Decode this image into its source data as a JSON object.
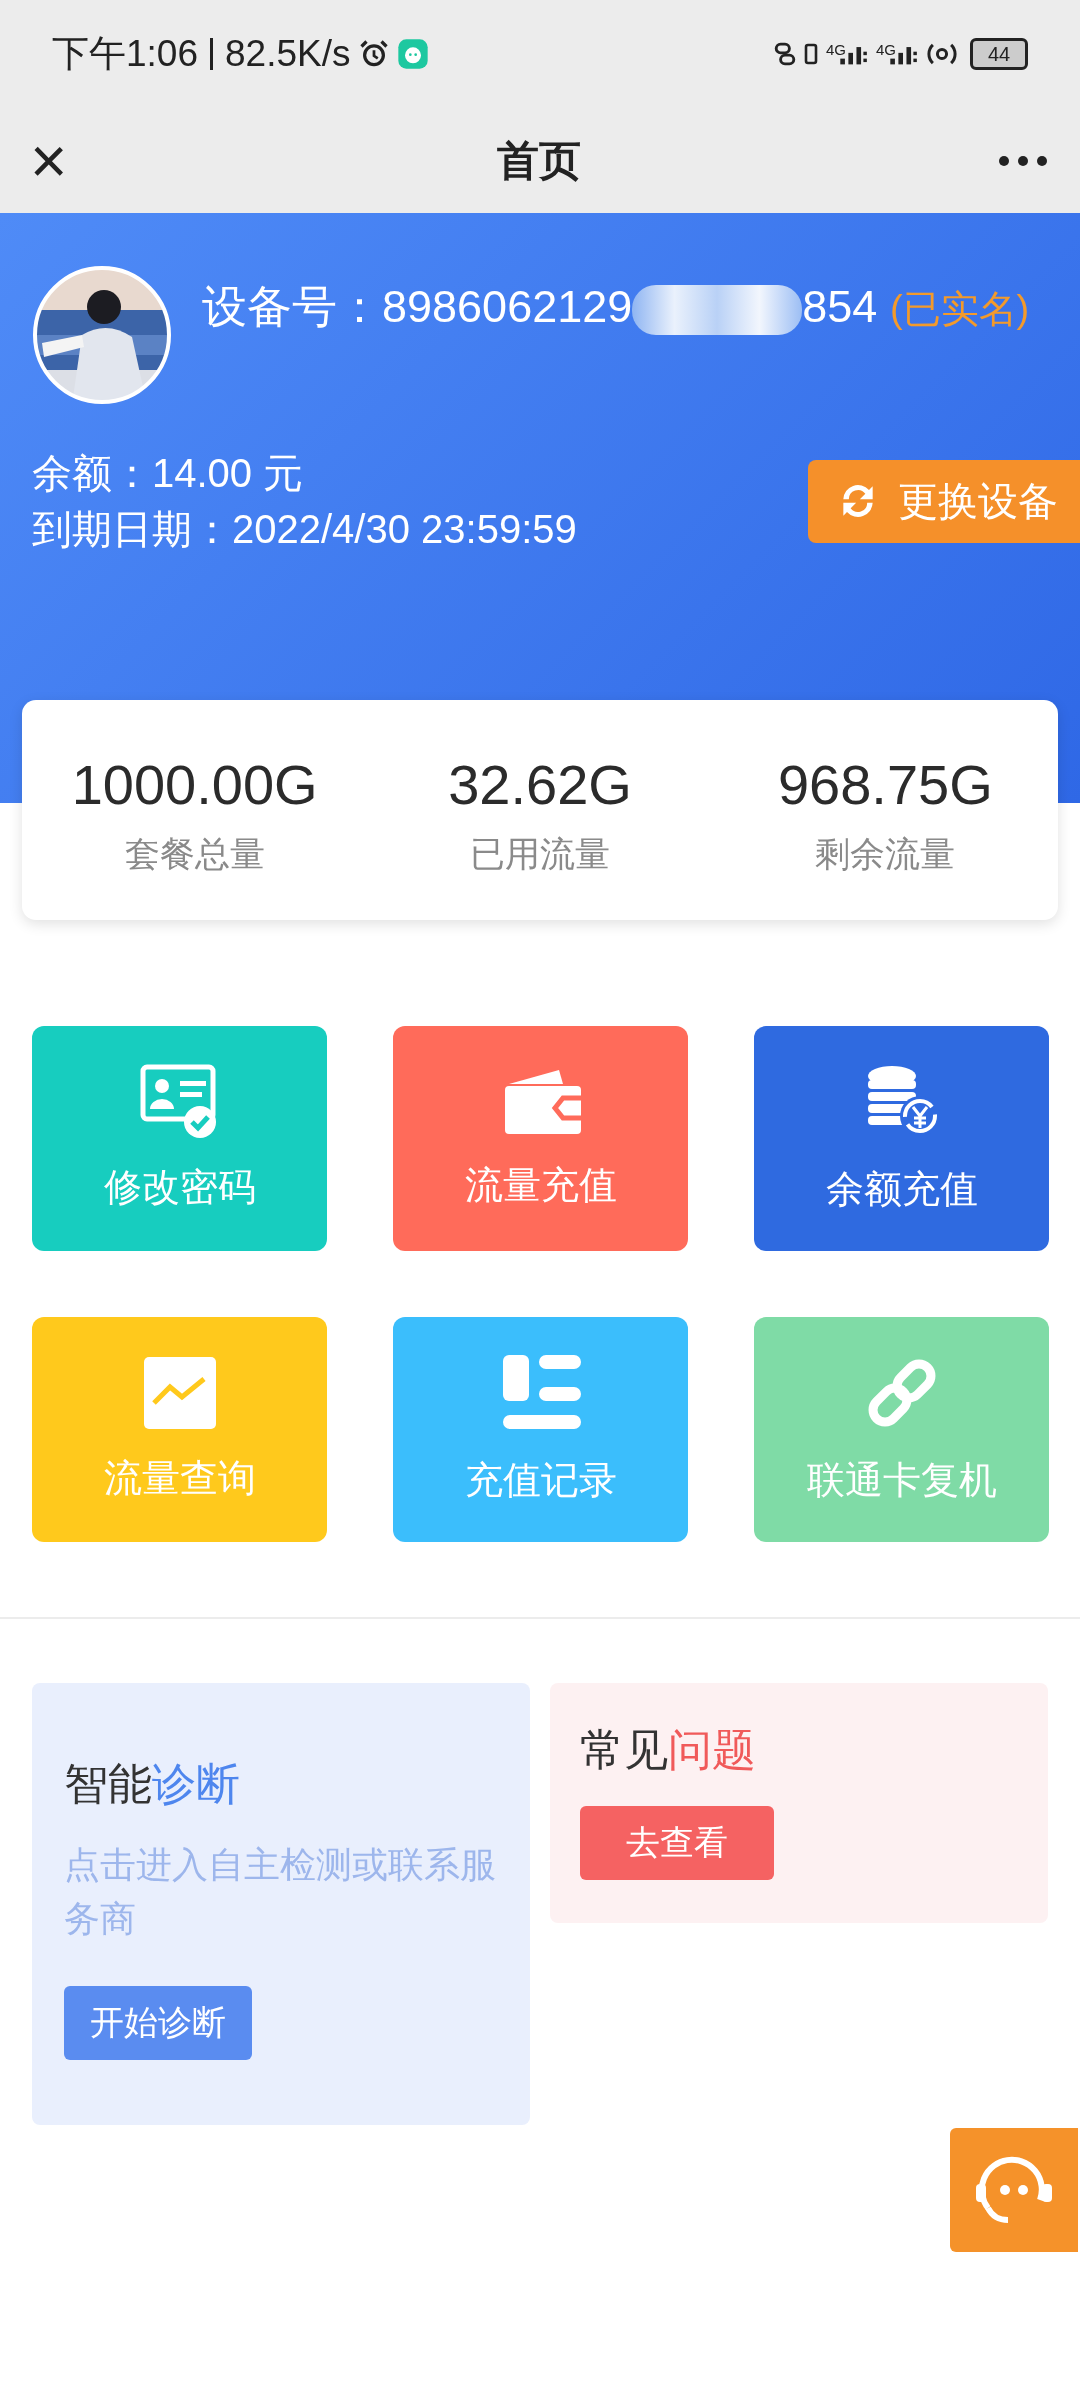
{
  "status_bar": {
    "time": "下午1:06",
    "speed": "82.5K/s",
    "signals": [
      {
        "network": "4G"
      },
      {
        "network": "4G"
      }
    ],
    "battery": "44"
  },
  "nav": {
    "title": "首页",
    "close": "×"
  },
  "device": {
    "label": "设备号：",
    "number_start": "8986062129",
    "number_end": "854",
    "verified": "(已实名)"
  },
  "balance": {
    "label": "余额：",
    "value": "14.00 元"
  },
  "expiry": {
    "label": "到期日期：",
    "value": "2022/4/30 23:59:59"
  },
  "switch_button": "更换设备",
  "stats": [
    {
      "value": "1000.00G",
      "label": "套餐总量"
    },
    {
      "value": "32.62G",
      "label": "已用流量"
    },
    {
      "value": "968.75G",
      "label": "剩余流量"
    }
  ],
  "tiles": [
    {
      "label": "修改密码",
      "kind": "id-card",
      "color": "#17cdbf"
    },
    {
      "label": "流量充值",
      "kind": "wallet",
      "color": "#ff6b5a"
    },
    {
      "label": "余额充值",
      "kind": "coins",
      "color": "#2f6ae0"
    },
    {
      "label": "流量查询",
      "kind": "chart",
      "color": "#ffc91c"
    },
    {
      "label": "充值记录",
      "kind": "list",
      "color": "#3bbefc"
    },
    {
      "label": "联通卡复机",
      "kind": "link",
      "color": "#7fdba6"
    }
  ],
  "diagnosis": {
    "title_plain": "智能",
    "title_accent": "诊断",
    "description": "点击进入自主检测或联系服务商",
    "button": "开始诊断"
  },
  "faq": {
    "title_plain": "常见",
    "title_accent": "问题",
    "button": "去查看"
  }
}
